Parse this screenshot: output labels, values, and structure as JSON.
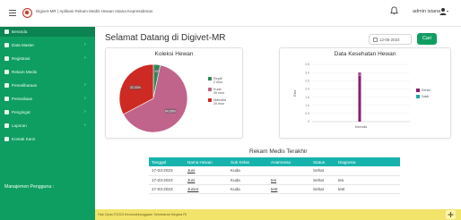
{
  "header": {
    "app_title": "Digivet-MR | Aplikasi Rekam Medis Hewan Istana Kepresidenan",
    "user_name": "admin istana"
  },
  "sidebar": {
    "items": [
      {
        "label": "Beranda",
        "has_chevron": false
      },
      {
        "label": "Data Master",
        "has_chevron": true
      },
      {
        "label": "Registrasi",
        "has_chevron": true
      },
      {
        "label": "Rekam Medis",
        "has_chevron": false
      },
      {
        "label": "Pemeliharaan",
        "has_chevron": true
      },
      {
        "label": "Persediaan",
        "has_chevron": true
      },
      {
        "label": "Pengingat",
        "has_chevron": true
      },
      {
        "label": "Laporan",
        "has_chevron": true
      },
      {
        "label": "Kontak Kami",
        "has_chevron": false
      }
    ],
    "section_title": "Manajemen Pengguna :"
  },
  "main": {
    "welcome": "Selamat Datang di Digivet-MR",
    "date_value": "12-05-2023",
    "search_button": "Cari"
  },
  "chart_data": [
    {
      "type": "pie",
      "title": "Koleksi Hewan",
      "slices": [
        {
          "label": "Reptil",
          "value": 2,
          "unit": "ekor",
          "pct": "3.33%",
          "color": "#2e8b57"
        },
        {
          "label": "Kuda",
          "value": 39,
          "unit": "ekor",
          "pct": "64.99%",
          "color": "#c0648c"
        },
        {
          "label": "Mamalia",
          "value": 20,
          "unit": "ekor",
          "pct": "33.33%",
          "color": "#cc2a22"
        }
      ],
      "legend_position": "right"
    },
    {
      "type": "bar",
      "title": "Data Kesehatan Hewan",
      "categories": [
        "Mamalia"
      ],
      "series": [
        {
          "name": "Sehat",
          "values": [
            3
          ],
          "color": "#8b1e6f"
        },
        {
          "name": "Sakit",
          "values": [
            0
          ],
          "color": "#1aa9a9"
        }
      ],
      "ylabel": "Ekor",
      "ylim": [
        0,
        3.5
      ],
      "yticks": [
        0,
        0.5,
        1.0,
        1.5,
        2.0,
        2.5,
        3.0,
        3.5
      ],
      "legend_position": "right"
    }
  ],
  "records": {
    "title": "Rekam Medis Terakhir",
    "columns": [
      "Tanggal",
      "Nama Hewan",
      "Sub Kelas",
      "Anamnesa",
      "Status",
      "Diagnosa"
    ],
    "rows": [
      [
        "17-03-2023",
        "Juni",
        "Kuda",
        "",
        "Sehat",
        ""
      ],
      [
        "17-03-2023",
        "Juni",
        "Kuda",
        "tes",
        "Sehat",
        "tes"
      ],
      [
        "17-03-2023",
        "Junior",
        "Kuda",
        "test",
        "Sehat",
        "test"
      ]
    ]
  },
  "footer": {
    "text": "Hak Cipta ©2023 Kerumahtanggaan Sekretariat Negara RI"
  },
  "colors": {
    "sidebar": "#0f9e61",
    "table_header": "#16b3ad",
    "footer": "#f2e36a"
  }
}
